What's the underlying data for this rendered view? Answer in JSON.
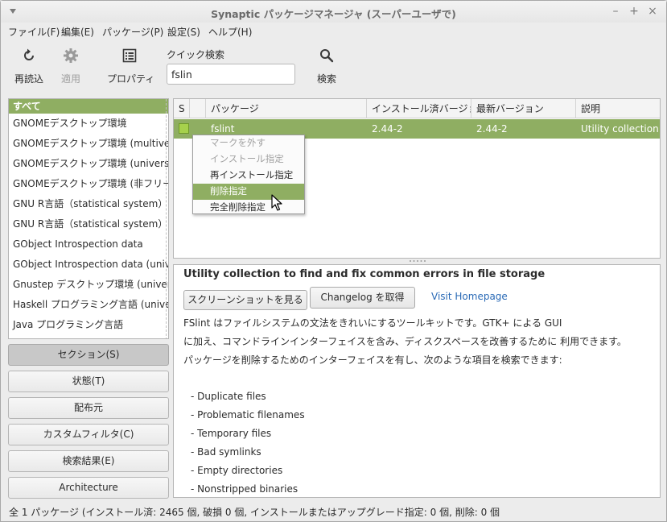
{
  "window": {
    "title": "Synaptic パッケージマネージャ (スーパーユーザで)",
    "controls": [
      "–",
      "+",
      "×"
    ]
  },
  "menubar": [
    "ファイル(F)",
    "編集(E)",
    "パッケージ(P)",
    "設定(S)",
    "ヘルプ(H)"
  ],
  "toolbar": {
    "reload": "再読込",
    "apply": "適用",
    "properties": "プロパティ",
    "quick_search_label": "クイック検索",
    "quick_search_value": "fslin",
    "search": "検索"
  },
  "categories": {
    "selected": "すべて",
    "items": [
      "GNOMEデスクトップ環境",
      "GNOMEデスクトップ環境 (multiverse)",
      "GNOMEデスクトップ環境 (universe)",
      "GNOMEデスクトップ環境 (非フリー)",
      "GNU R言語（statistical system）(multiverse)",
      "GNU R言語（statistical system）(universe)",
      "GObject Introspection data",
      "GObject Introspection data (universe)",
      "Gnustep デスクトップ環境 (universe)",
      "Haskell プログラミング言語 (universe)",
      "Java プログラミング言語"
    ]
  },
  "filter_buttons": {
    "section": "セクション(S)",
    "status": "状態(T)",
    "origin": "配布元",
    "custom": "カスタムフィルタ(C)",
    "search_results": "検索結果(E)",
    "architecture": "Architecture"
  },
  "package_table": {
    "columns": {
      "s": "S",
      "package": "パッケージ",
      "installed": "インストール済バージョン",
      "latest": "最新バージョン",
      "description": "説明"
    },
    "row": {
      "name": "fslint",
      "installed": "2.44-2",
      "latest": "2.44-2",
      "description": "Utility collection to find and fix common errors in file storage"
    }
  },
  "context_menu": {
    "unmark": "マークを外す",
    "install": "インストール指定",
    "reinstall": "再インストール指定",
    "remove": "削除指定",
    "purge": "完全削除指定"
  },
  "details": {
    "title": "Utility collection to find and fix common errors in file storage",
    "screenshot_button": "スクリーンショットを見る",
    "changelog_button": "Changelog を取得",
    "homepage_link": "Visit Homepage",
    "desc_lines": [
      "FSlint はファイルシステムの文法をきれいにするツールキットです。GTK+ による GUI",
      "に加え、コマンドラインインターフェイスを含み、ディスクスペースを改善するために 利用できます。",
      "パッケージを削除するためのインターフェイスを有し、次のような項目を検索できます:"
    ],
    "bullets": [
      "- Duplicate files",
      "- Problematic filenames",
      "- Temporary files",
      "- Bad symlinks",
      "- Empty directories",
      "- Nonstripped binaries"
    ]
  },
  "statusbar": "全 1 パッケージ (インストール済: 2465 個, 破損 0 個, インストールまたはアップグレード指定: 0 個, 削除: 0 個",
  "colors": {
    "selection": "#8fae62",
    "link": "#2a6ab6",
    "status_installed": "#a6d14c"
  }
}
